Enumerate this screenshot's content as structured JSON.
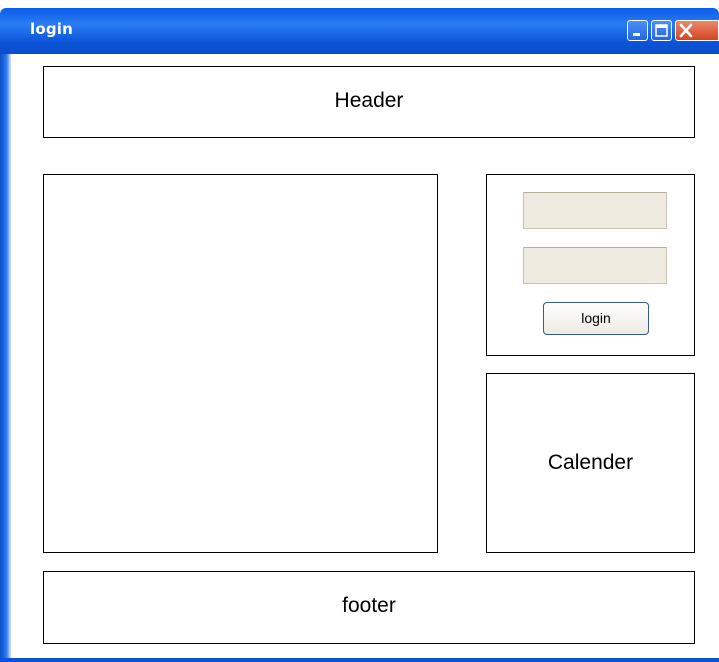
{
  "window": {
    "title": "login"
  },
  "header": {
    "label": "Header"
  },
  "login_panel": {
    "username_value": "",
    "password_value": "",
    "button_label": "login"
  },
  "calendar": {
    "label": "Calender"
  },
  "footer": {
    "label": "footer"
  },
  "icons": {
    "minimize": "minimize-icon",
    "maximize": "maximize-icon",
    "close": "close-icon"
  },
  "colors": {
    "title_bar": "#0b54d8",
    "field_background": "#efebe1",
    "close_button": "#d4451f"
  }
}
